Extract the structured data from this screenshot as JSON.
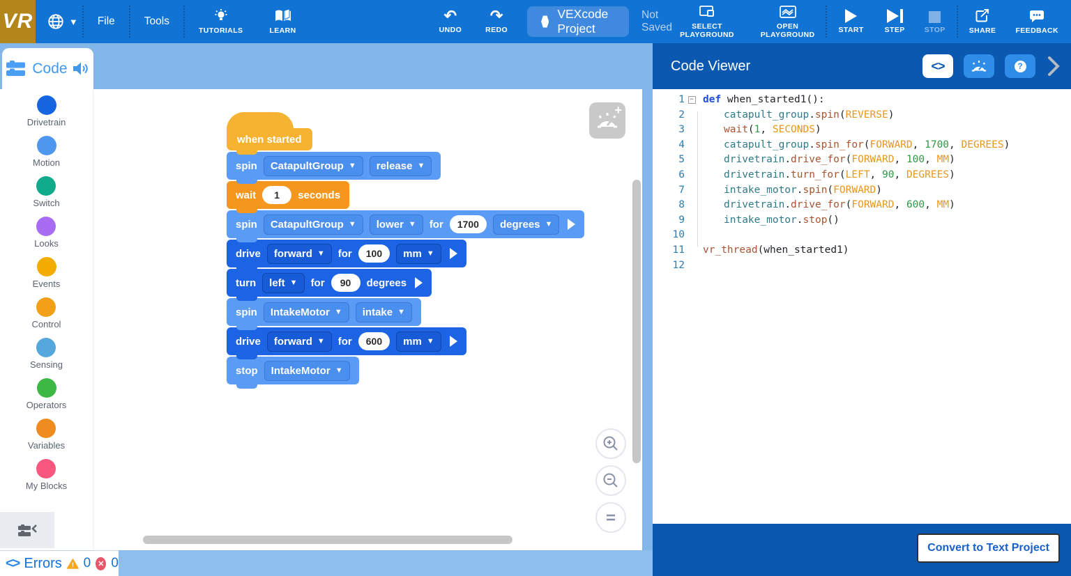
{
  "topbar": {
    "logo": "VR",
    "file": "File",
    "tools": "Tools",
    "tutorials": "TUTORIALS",
    "learn": "LEARN",
    "undo": "UNDO",
    "redo": "REDO",
    "project_title": "VEXcode Project",
    "save_status": "Not Saved",
    "select_playground": "SELECT PLAYGROUND",
    "open_playground": "OPEN PLAYGROUND",
    "start": "START",
    "step": "STEP",
    "stop": "STOP",
    "share": "SHARE",
    "feedback": "FEEDBACK"
  },
  "sidebar": {
    "tab_label": "Code",
    "categories": [
      {
        "label": "Drivetrain",
        "color": "#1565e0"
      },
      {
        "label": "Motion",
        "color": "#4e97ef"
      },
      {
        "label": "Switch",
        "color": "#0fab8a"
      },
      {
        "label": "Looks",
        "color": "#a76cf2"
      },
      {
        "label": "Events",
        "color": "#f2ad00"
      },
      {
        "label": "Control",
        "color": "#f2a018"
      },
      {
        "label": "Sensing",
        "color": "#56a8dc"
      },
      {
        "label": "Operators",
        "color": "#3eb844"
      },
      {
        "label": "Variables",
        "color": "#ef8c1f"
      },
      {
        "label": "My Blocks",
        "color": "#f9587e"
      }
    ]
  },
  "block_colors": {
    "events": {
      "bg": "#f5b331",
      "ddc": "#f5b331",
      "ddb": "#d99a12"
    },
    "control": {
      "bg": "#f5971d",
      "ddc": "#f5971d",
      "ddb": "#d97f0a"
    },
    "motion": {
      "bg": "#5a9cf5",
      "ddc": "#4a8eee",
      "ddb": "#3a79d6"
    },
    "drivetrain": {
      "bg": "#1c64e4",
      "ddc": "#175bd6",
      "ddb": "#0e47ad"
    }
  },
  "canvas": {
    "blocks": [
      {
        "name": "when-started-block",
        "shape": "hat",
        "category": "events",
        "parts": [
          {
            "k": "label",
            "t": "when started"
          }
        ]
      },
      {
        "name": "spin-catapult-release-block",
        "shape": "stack",
        "category": "motion",
        "parts": [
          {
            "k": "label",
            "t": "spin"
          },
          {
            "k": "dropdown",
            "t": "CatapultGroup"
          },
          {
            "k": "dropdown",
            "t": "release"
          }
        ]
      },
      {
        "name": "wait-block",
        "shape": "stack",
        "category": "control",
        "parts": [
          {
            "k": "label",
            "t": "wait"
          },
          {
            "k": "input",
            "t": "1"
          },
          {
            "k": "label",
            "t": "seconds"
          }
        ]
      },
      {
        "name": "spin-catapult-lower-block",
        "shape": "stack",
        "category": "motion",
        "parts": [
          {
            "k": "label",
            "t": "spin"
          },
          {
            "k": "dropdown",
            "t": "CatapultGroup"
          },
          {
            "k": "dropdown",
            "t": "lower"
          },
          {
            "k": "label",
            "t": "for"
          },
          {
            "k": "input",
            "t": "1700"
          },
          {
            "k": "dropdown",
            "t": "degrees"
          },
          {
            "k": "expand"
          }
        ]
      },
      {
        "name": "drive-forward-100-block",
        "shape": "stack",
        "category": "drivetrain",
        "parts": [
          {
            "k": "label",
            "t": "drive"
          },
          {
            "k": "dropdown",
            "t": "forward"
          },
          {
            "k": "label",
            "t": "for"
          },
          {
            "k": "input",
            "t": "100"
          },
          {
            "k": "dropdown",
            "t": "mm"
          },
          {
            "k": "expand"
          }
        ]
      },
      {
        "name": "turn-left-90-block",
        "shape": "stack",
        "category": "drivetrain",
        "parts": [
          {
            "k": "label",
            "t": "turn"
          },
          {
            "k": "dropdown",
            "t": "left"
          },
          {
            "k": "label",
            "t": "for"
          },
          {
            "k": "input",
            "t": "90"
          },
          {
            "k": "label",
            "t": "degrees"
          },
          {
            "k": "expand"
          }
        ]
      },
      {
        "name": "spin-intake-block",
        "shape": "stack",
        "category": "motion",
        "parts": [
          {
            "k": "label",
            "t": "spin"
          },
          {
            "k": "dropdown",
            "t": "IntakeMotor"
          },
          {
            "k": "dropdown",
            "t": "intake"
          }
        ]
      },
      {
        "name": "drive-forward-600-block",
        "shape": "stack",
        "category": "drivetrain",
        "parts": [
          {
            "k": "label",
            "t": "drive"
          },
          {
            "k": "dropdown",
            "t": "forward"
          },
          {
            "k": "label",
            "t": "for"
          },
          {
            "k": "input",
            "t": "600"
          },
          {
            "k": "dropdown",
            "t": "mm"
          },
          {
            "k": "expand"
          }
        ]
      },
      {
        "name": "stop-intake-block",
        "shape": "stack",
        "category": "motion",
        "parts": [
          {
            "k": "label",
            "t": "stop"
          },
          {
            "k": "dropdown",
            "t": "IntakeMotor"
          }
        ]
      }
    ]
  },
  "code_viewer": {
    "title": "Code Viewer",
    "convert_label": "Convert to Text Project",
    "lines": [
      {
        "n": "1",
        "indent": false,
        "fold": true,
        "seg": [
          {
            "t": "def",
            "c": "kw"
          },
          {
            "t": " when_started1():",
            "c": "pl"
          }
        ]
      },
      {
        "n": "2",
        "indent": true,
        "seg": [
          {
            "t": "catapult_group",
            "c": "obj"
          },
          {
            "t": ".",
            "c": "pl"
          },
          {
            "t": "spin",
            "c": "meth"
          },
          {
            "t": "(",
            "c": "pl"
          },
          {
            "t": "REVERSE",
            "c": "const"
          },
          {
            "t": ")",
            "c": "pl"
          }
        ]
      },
      {
        "n": "3",
        "indent": true,
        "seg": [
          {
            "t": "wait",
            "c": "meth"
          },
          {
            "t": "(",
            "c": "pl"
          },
          {
            "t": "1",
            "c": "num"
          },
          {
            "t": ", ",
            "c": "pl"
          },
          {
            "t": "SECONDS",
            "c": "const"
          },
          {
            "t": ")",
            "c": "pl"
          }
        ]
      },
      {
        "n": "4",
        "indent": true,
        "seg": [
          {
            "t": "catapult_group",
            "c": "obj"
          },
          {
            "t": ".",
            "c": "pl"
          },
          {
            "t": "spin_for",
            "c": "meth"
          },
          {
            "t": "(",
            "c": "pl"
          },
          {
            "t": "FORWARD",
            "c": "const"
          },
          {
            "t": ", ",
            "c": "pl"
          },
          {
            "t": "1700",
            "c": "num"
          },
          {
            "t": ", ",
            "c": "pl"
          },
          {
            "t": "DEGREES",
            "c": "const"
          },
          {
            "t": ")",
            "c": "pl"
          }
        ]
      },
      {
        "n": "5",
        "indent": true,
        "seg": [
          {
            "t": "drivetrain",
            "c": "obj"
          },
          {
            "t": ".",
            "c": "pl"
          },
          {
            "t": "drive_for",
            "c": "meth"
          },
          {
            "t": "(",
            "c": "pl"
          },
          {
            "t": "FORWARD",
            "c": "const"
          },
          {
            "t": ", ",
            "c": "pl"
          },
          {
            "t": "100",
            "c": "num"
          },
          {
            "t": ", ",
            "c": "pl"
          },
          {
            "t": "MM",
            "c": "const"
          },
          {
            "t": ")",
            "c": "pl"
          }
        ]
      },
      {
        "n": "6",
        "indent": true,
        "seg": [
          {
            "t": "drivetrain",
            "c": "obj"
          },
          {
            "t": ".",
            "c": "pl"
          },
          {
            "t": "turn_for",
            "c": "meth"
          },
          {
            "t": "(",
            "c": "pl"
          },
          {
            "t": "LEFT",
            "c": "const"
          },
          {
            "t": ", ",
            "c": "pl"
          },
          {
            "t": "90",
            "c": "num"
          },
          {
            "t": ", ",
            "c": "pl"
          },
          {
            "t": "DEGREES",
            "c": "const"
          },
          {
            "t": ")",
            "c": "pl"
          }
        ]
      },
      {
        "n": "7",
        "indent": true,
        "seg": [
          {
            "t": "intake_motor",
            "c": "obj"
          },
          {
            "t": ".",
            "c": "pl"
          },
          {
            "t": "spin",
            "c": "meth"
          },
          {
            "t": "(",
            "c": "pl"
          },
          {
            "t": "FORWARD",
            "c": "const"
          },
          {
            "t": ")",
            "c": "pl"
          }
        ]
      },
      {
        "n": "8",
        "indent": true,
        "seg": [
          {
            "t": "drivetrain",
            "c": "obj"
          },
          {
            "t": ".",
            "c": "pl"
          },
          {
            "t": "drive_for",
            "c": "meth"
          },
          {
            "t": "(",
            "c": "pl"
          },
          {
            "t": "FORWARD",
            "c": "const"
          },
          {
            "t": ", ",
            "c": "pl"
          },
          {
            "t": "600",
            "c": "num"
          },
          {
            "t": ", ",
            "c": "pl"
          },
          {
            "t": "MM",
            "c": "const"
          },
          {
            "t": ")",
            "c": "pl"
          }
        ]
      },
      {
        "n": "9",
        "indent": true,
        "seg": [
          {
            "t": "intake_motor",
            "c": "obj"
          },
          {
            "t": ".",
            "c": "pl"
          },
          {
            "t": "stop",
            "c": "meth"
          },
          {
            "t": "()",
            "c": "pl"
          }
        ]
      },
      {
        "n": "10",
        "indent": false,
        "seg": []
      },
      {
        "n": "11",
        "indent": false,
        "seg": [
          {
            "t": "vr_thread",
            "c": "meth"
          },
          {
            "t": "(when_started1)",
            "c": "pl"
          }
        ]
      },
      {
        "n": "12",
        "indent": false,
        "seg": []
      }
    ]
  },
  "errors_bar": {
    "label": "Errors",
    "warning_count": "0",
    "error_count": "0"
  },
  "accent_colors": {
    "toolbar_blue": "#1174d4",
    "logo_gold": "#b2861b",
    "panel_blue": "#0b58b0",
    "workspace_light_blue": "#83b7ea"
  }
}
